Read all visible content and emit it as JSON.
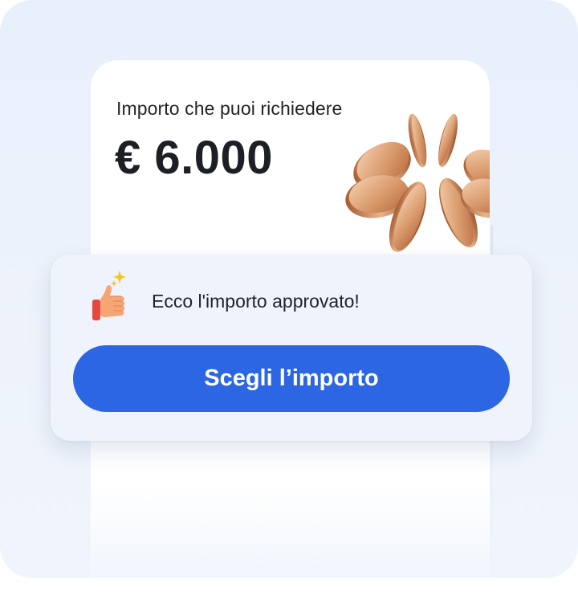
{
  "card": {
    "label": "Importo che puoi richiedere",
    "amount": "€ 6.000",
    "illustration": "coins-icon"
  },
  "popup": {
    "icon": "thumbs-up-sparkle-icon",
    "message": "Ecco l'importo approvato!",
    "button_label": "Scegli l’importo"
  },
  "colors": {
    "accent": "#2D66E3",
    "background": "#E8F0FC",
    "card": "#FFFFFF",
    "popup": "#EFF3FB",
    "text": "#1F2329"
  }
}
